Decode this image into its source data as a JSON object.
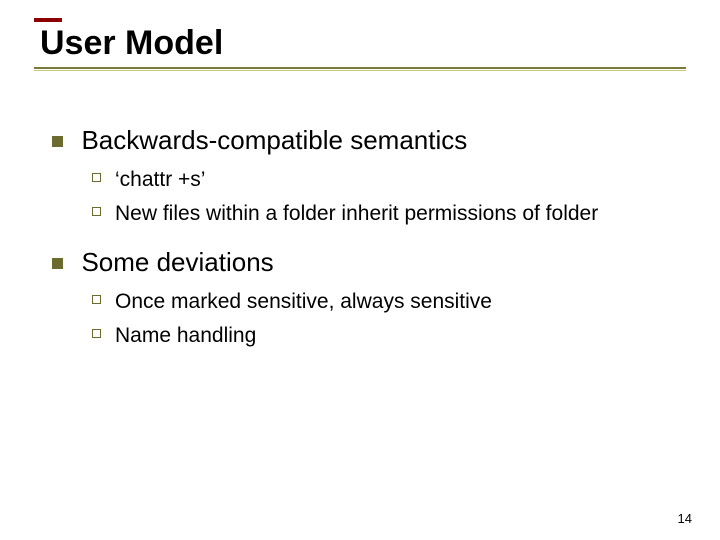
{
  "title": "User Model",
  "bullets": [
    {
      "text": "Backwards-compatible semantics",
      "sub": [
        "‘chattr +s’",
        "New files within a folder inherit permissions of folder"
      ]
    },
    {
      "text": "Some deviations",
      "sub": [
        "Once marked sensitive, always sensitive",
        "Name handling"
      ]
    }
  ],
  "page_number": "14"
}
